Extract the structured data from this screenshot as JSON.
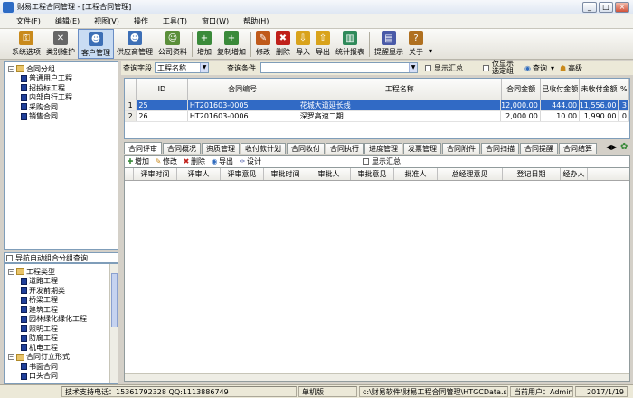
{
  "window": {
    "title": "财易工程合同管理 - [工程合同管理]",
    "minimize": "_",
    "restore": "□",
    "close": "×"
  },
  "menu": [
    "文件(F)",
    "编辑(E)",
    "视图(V)",
    "操作",
    "工具(T)",
    "窗口(W)",
    "帮助(H)"
  ],
  "toolbar": [
    {
      "label": "系统选项",
      "icon": "key-icon",
      "color": "#c98a1c",
      "glyph": "⚿"
    },
    {
      "label": "类别维护",
      "icon": "tools-icon",
      "color": "#666666",
      "glyph": "✕"
    },
    {
      "label": "客户管理",
      "icon": "customer-icon",
      "color": "#3d6fb6",
      "glyph": "☻"
    },
    {
      "label": "供应商管理",
      "icon": "supplier-icon",
      "color": "#3d6fb6",
      "glyph": "☻"
    },
    {
      "label": "公司资料",
      "icon": "company-icon",
      "color": "#5b8f3a",
      "glyph": "☺"
    },
    {
      "label": "增加",
      "icon": "add-icon",
      "color": "#3a8a3a",
      "glyph": "+"
    },
    {
      "label": "复制增加",
      "icon": "copy-add-icon",
      "color": "#3a8a3a",
      "glyph": "+"
    },
    {
      "label": "修改",
      "icon": "edit-icon",
      "color": "#c05a1a",
      "glyph": "✎"
    },
    {
      "label": "删除",
      "icon": "delete-icon",
      "color": "#c0201a",
      "glyph": "✖"
    },
    {
      "label": "导入",
      "icon": "import-icon",
      "color": "#d9a31c",
      "glyph": "⇩"
    },
    {
      "label": "导出",
      "icon": "export-icon",
      "color": "#d9a31c",
      "glyph": "⇧"
    },
    {
      "label": "统计报表",
      "icon": "report-icon",
      "color": "#2f8a5a",
      "glyph": "▥"
    },
    {
      "label": "提醒显示",
      "icon": "reminder-icon",
      "color": "#4a5aa8",
      "glyph": "▤"
    },
    {
      "label": "关于",
      "icon": "help-icon",
      "color": "#b07020",
      "glyph": "?"
    }
  ],
  "left_tree": {
    "root": "合同分组",
    "items": [
      "普通用户工程",
      "招投标工程",
      "内部自行工程",
      "采购合同",
      "销售合同"
    ]
  },
  "left_nav": {
    "header": "导航自动组合分组查询",
    "groups": [
      {
        "label": "工程类型",
        "children": [
          "道路工程",
          "开发前期类",
          "桥梁工程",
          "建筑工程",
          "园林绿化绿化工程",
          "照明工程",
          "防腐工程",
          "机电工程"
        ]
      },
      {
        "label": "合同订立形式",
        "children": [
          "书面合同",
          "口头合同"
        ]
      }
    ]
  },
  "query": {
    "field_label": "查询字段",
    "field_value": "工程名称",
    "cond_label": "查询条件",
    "cond_value": "",
    "show_summary": "显示汇总",
    "only_show": "仅显示选定组",
    "query_btn": "查询",
    "advanced_btn": "高级"
  },
  "contracts": {
    "columns": [
      "",
      "ID",
      "合同编号",
      "工程名称",
      "合同金额",
      "已收付金额",
      "未收付金额",
      "%"
    ],
    "rows": [
      {
        "rn": "1",
        "id": "25",
        "code": "HT201603-0005",
        "name": "花城大道延长线",
        "amount": "12,000.00",
        "paid": "444.00",
        "unpaid": "11,556.00",
        "pct": "3"
      },
      {
        "rn": "2",
        "id": "26",
        "code": "HT201603-0006",
        "name": "深罗高速二期",
        "amount": "2,000.00",
        "paid": "10.00",
        "unpaid": "1,990.00",
        "pct": "0"
      }
    ]
  },
  "tabs": [
    "合同评审",
    "合同概况",
    "资质管理",
    "收付款计划",
    "合同收付",
    "合同执行",
    "进度管理",
    "发票管理",
    "合同附件",
    "合同扫描",
    "合同提醒",
    "合同结算"
  ],
  "subtool": {
    "add": "增加",
    "edit": "修改",
    "delete": "删除",
    "export": "导出",
    "design": "设计",
    "show_summary": "显示汇总"
  },
  "review_columns": [
    "评审时间",
    "评审人",
    "评审意见",
    "审批时间",
    "审批人",
    "审批意见",
    "批准人",
    "总经理意见",
    "登记日期",
    "经办人"
  ],
  "status": {
    "support": "技术支持电话：15361792328 QQ:1113886749",
    "mode": "单机版",
    "path": "c:\\财易软件\\财易工程合同管理\\HTGCData.sys",
    "user": "当前用户：Admin",
    "date": "2017/1/19"
  }
}
